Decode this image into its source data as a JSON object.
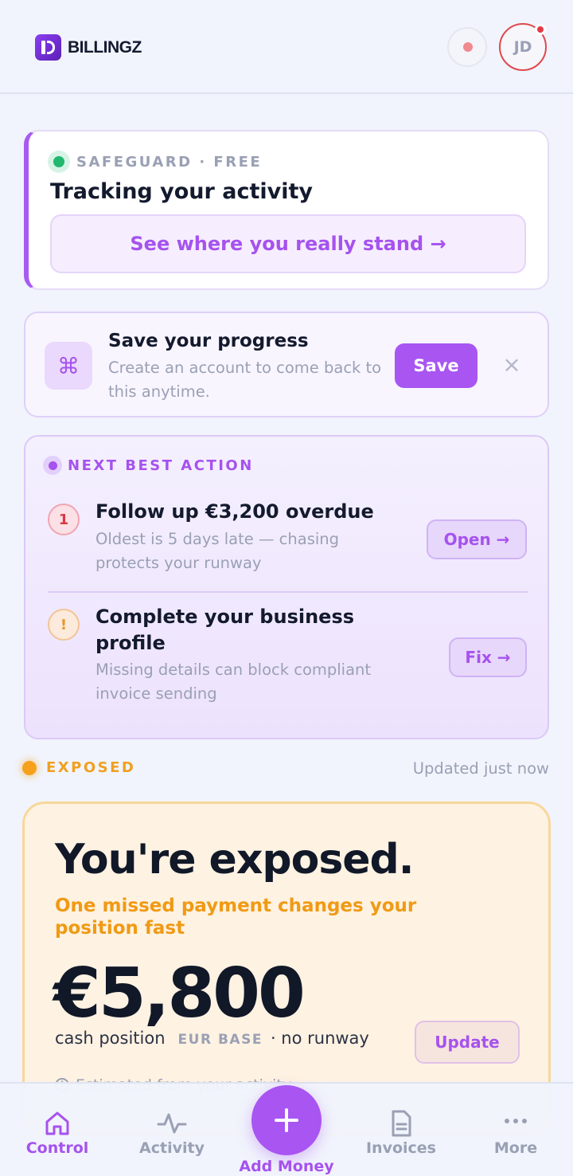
{
  "header": {
    "logo_text": "BILLINGZ",
    "avatar_initials": "JD",
    "notification_color": "#f08a8f"
  },
  "safeguard": {
    "status_label": "SAFEGUARD · FREE",
    "title": "Tracking your activity",
    "link_label": "See where you really stand →",
    "status_color": "#1fb86e"
  },
  "save_card": {
    "icon": "command-icon",
    "title": "Save your progress",
    "description": "Create an account to come back to this anytime.",
    "button_label": "Save",
    "close_label": "×"
  },
  "next_best_action": {
    "label": "NEXT BEST ACTION",
    "items": [
      {
        "badge": "1",
        "title": "Follow up €3,200 overdue",
        "description": "Oldest is 5 days late — chasing protects your runway",
        "button_label": "Open →"
      },
      {
        "badge": "!",
        "title": "Complete your business profile",
        "description": "Missing details can block compliant invoice sending",
        "button_label": "Fix →"
      }
    ]
  },
  "position": {
    "status_label": "EXPOSED",
    "updated_text": "Updated just now",
    "title": "You're exposed.",
    "subtitle": "One missed payment changes your position fast",
    "amount": "€5,800",
    "position_label": "cash position",
    "currency_label": "EUR BASE",
    "runway_text": "· no runway",
    "update_button": "Update",
    "estimate_text": "Estimated from your activity ·",
    "accent_color": "#f6a11c"
  },
  "bottom_nav": {
    "items": [
      {
        "label": "Control",
        "icon": "home-icon",
        "active": true
      },
      {
        "label": "Activity",
        "icon": "pulse-icon",
        "active": false
      },
      {
        "label": "Add Money",
        "icon": "plus-icon",
        "active": false
      },
      {
        "label": "Invoices",
        "icon": "document-icon",
        "active": false
      },
      {
        "label": "More",
        "icon": "more-icon",
        "active": false
      }
    ]
  },
  "colors": {
    "accent": "#a855f2",
    "background": "#f1f4fc"
  }
}
